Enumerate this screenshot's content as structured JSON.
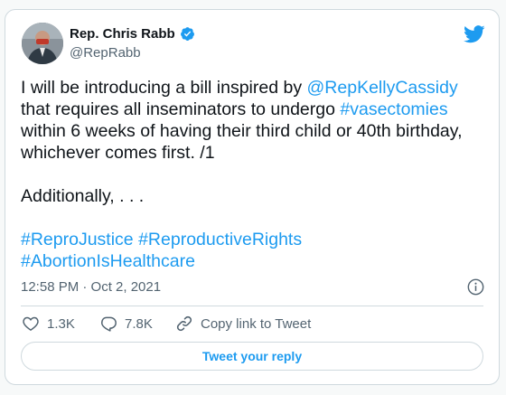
{
  "author": {
    "name": "Rep. Chris Rabb",
    "handle": "@RepRabb",
    "verified_icon": "verified-badge-icon",
    "avatar_icon": "profile-photo"
  },
  "brand": {
    "logo": "twitter-bird-icon",
    "accent_color": "#1d9bf0"
  },
  "tweet": {
    "lines": [
      [
        {
          "text": "I will be introducing a bill inspired by "
        },
        {
          "text": "@RepKellyCassidy",
          "link": true
        }
      ],
      [
        {
          "text": "that requires all inseminators to undergo "
        },
        {
          "text": "#vasectomies",
          "link": true
        }
      ],
      [
        {
          "text": "within 6 weeks of having their third child or 40th birthday,"
        }
      ],
      [
        {
          "text": "whichever comes first. /1"
        }
      ],
      [],
      [
        {
          "text": "Additionally, . . ."
        }
      ],
      [],
      [
        {
          "text": "#ReproJustice",
          "link": true
        },
        {
          "text": " "
        },
        {
          "text": "#ReproductiveRights",
          "link": true
        }
      ],
      [
        {
          "text": "#AbortionIsHealthcare",
          "link": true
        }
      ]
    ],
    "timestamp": "12:58 PM · Oct 2, 2021"
  },
  "actions": {
    "likes": "1.3K",
    "replies": "7.8K",
    "copy_link": "Copy link to Tweet"
  },
  "reply_button": {
    "label": "Tweet your reply"
  }
}
